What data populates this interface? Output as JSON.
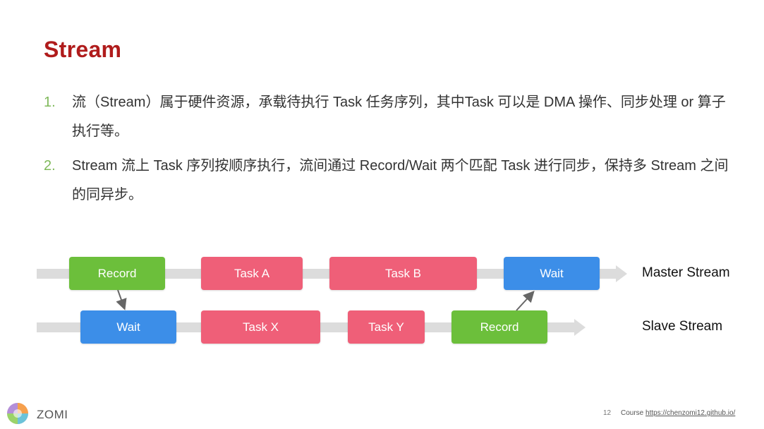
{
  "title": "Stream",
  "bullets": [
    {
      "num": "1.",
      "text": "流（Stream）属于硬件资源，承载待执行 Task 任务序列，其中Task 可以是 DMA 操作、同步处理 or 算子执行等。"
    },
    {
      "num": "2.",
      "text": "Stream 流上 Task 序列按顺序执行，流间通过 Record/Wait 两个匹配 Task 进行同步，保持多 Stream 之间的同异步。"
    }
  ],
  "diagram": {
    "master": {
      "label": "Master Stream",
      "tasks": [
        {
          "name": "Record",
          "kind": "green"
        },
        {
          "name": "Task A",
          "kind": "red"
        },
        {
          "name": "Task B",
          "kind": "red"
        },
        {
          "name": "Wait",
          "kind": "blue"
        }
      ]
    },
    "slave": {
      "label": "Slave Stream",
      "tasks": [
        {
          "name": "Wait",
          "kind": "blue"
        },
        {
          "name": "Task X",
          "kind": "red"
        },
        {
          "name": "Task Y",
          "kind": "red"
        },
        {
          "name": "Record",
          "kind": "green"
        }
      ]
    },
    "colors": {
      "green": "#6cbf3b",
      "red": "#ef5f78",
      "blue": "#3c8ee8",
      "track": "#dcdcdc"
    }
  },
  "footer": {
    "brand": "ZOMI",
    "page": "12",
    "course_prefix": "Course",
    "course_link": "https://chenzomi12.github.io/"
  }
}
